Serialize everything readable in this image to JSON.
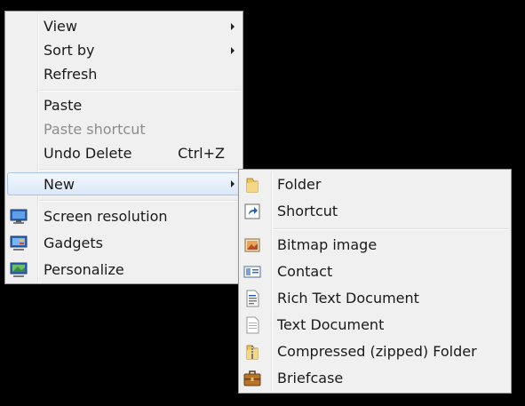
{
  "main_menu": {
    "items": [
      {
        "label": "View",
        "has_submenu": true
      },
      {
        "label": "Sort by",
        "has_submenu": true
      },
      {
        "label": "Refresh"
      },
      {
        "label": "Paste"
      },
      {
        "label": "Paste shortcut",
        "disabled": true
      },
      {
        "label": "Undo Delete",
        "shortcut": "Ctrl+Z"
      },
      {
        "label": "New",
        "has_submenu": true,
        "highlighted": true
      },
      {
        "label": "Screen resolution",
        "icon": "screen-resolution-icon"
      },
      {
        "label": "Gadgets",
        "icon": "gadgets-icon"
      },
      {
        "label": "Personalize",
        "icon": "personalize-icon"
      }
    ]
  },
  "new_submenu": {
    "items": [
      {
        "label": "Folder",
        "icon": "folder-icon"
      },
      {
        "label": "Shortcut",
        "icon": "shortcut-icon"
      },
      {
        "label": "Bitmap image",
        "icon": "bitmap-image-icon"
      },
      {
        "label": "Contact",
        "icon": "contact-icon"
      },
      {
        "label": "Rich Text Document",
        "icon": "rich-text-document-icon"
      },
      {
        "label": "Text Document",
        "icon": "text-document-icon"
      },
      {
        "label": "Compressed (zipped) Folder",
        "icon": "zipped-folder-icon"
      },
      {
        "label": "Briefcase",
        "icon": "briefcase-icon"
      }
    ]
  },
  "colors": {
    "menu_background": "#f0f0f0",
    "highlight_border": "#a9c4ea",
    "disabled_text": "#8d8d8d",
    "desktop_background": "#000000"
  }
}
